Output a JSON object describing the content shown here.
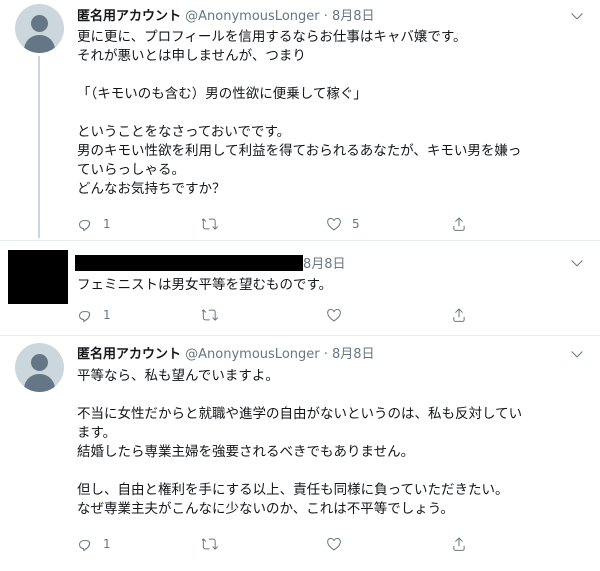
{
  "tweets": [
    {
      "name": "匿名用アカウント",
      "handle": "@AnonymousLonger",
      "sep": " · ",
      "date": "8月8日",
      "text": "更に更に、プロフィールを信用するならお仕事はキャバ嬢です。\nそれが悪いとは申しませんが、つまり\n\n「（キモいのも含む）男の性欲に便乗して稼ぐ」\n\nということをなさっておいでです。\n男のキモい性欲を利用して利益を得ておられるあなたが、キモい男を嫌っ\nていらっしゃる。\nどんなお気持ちですか？",
      "reply_count": "1",
      "retweet_count": "",
      "like_count": "5"
    },
    {
      "name": "",
      "handle": "",
      "sep": "",
      "date": "8月8日",
      "text": "フェミニストは男女平等を望むものです。",
      "reply_count": "1",
      "retweet_count": "",
      "like_count": ""
    },
    {
      "name": "匿名用アカウント",
      "handle": "@AnonymousLonger",
      "sep": " · ",
      "date": "8月8日",
      "text": "平等なら、私も望んでいますよ。\n\n不当に女性だからと就職や進学の自由がないというのは、私も反対してい\nます。\n結婚したら専業主婦を強要されるべきでもありません。\n\n但し、自由と権利を手にする以上、責任も同様に負っていただきたい。\nなぜ専業主夫がこんなに少ないのか、これは不平等でしょう。",
      "reply_count": "1",
      "retweet_count": "",
      "like_count": ""
    }
  ],
  "icons": [
    "reply-icon",
    "retweet-icon",
    "like-icon",
    "share-icon",
    "chevron-down-icon",
    "default-avatar-icon"
  ],
  "colors": {
    "icon": "#657786",
    "divider": "#e6ecf0",
    "thread_line": "#ccd6dd"
  }
}
